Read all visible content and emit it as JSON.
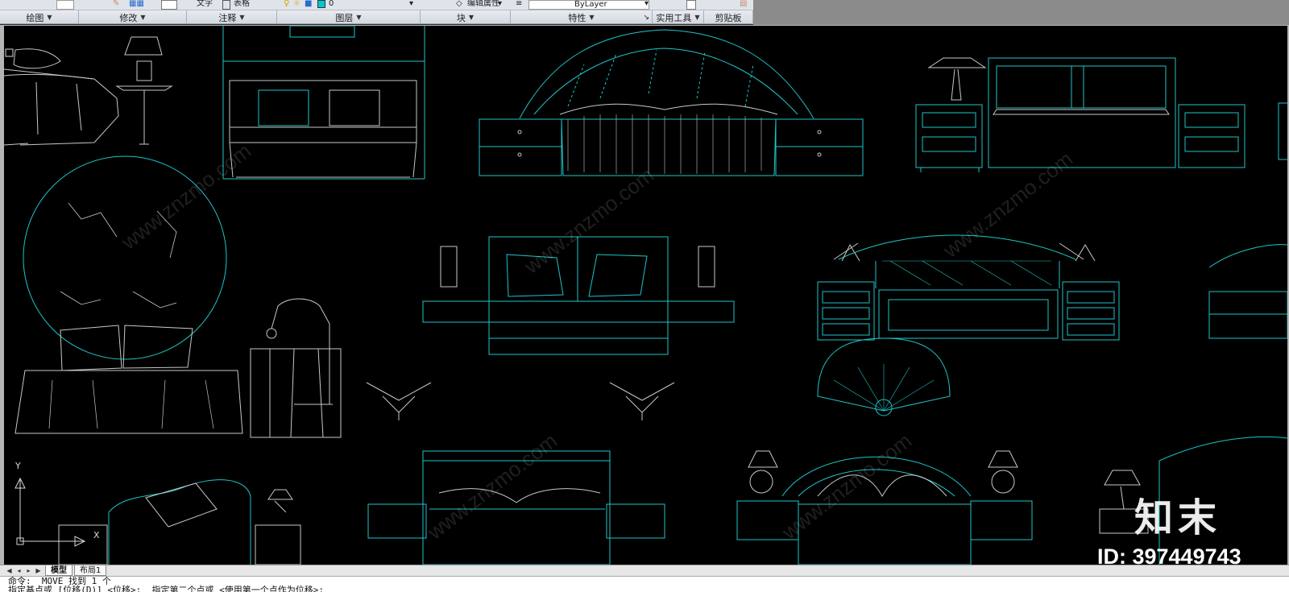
{
  "ribbon_top": {
    "text_label": "文字",
    "table_label": "表格",
    "layer_value": "0",
    "edit_attr_label": "编辑属性",
    "linetype_value": "ByLayer"
  },
  "ribbon_panels": [
    {
      "label": "绘图"
    },
    {
      "label": "修改"
    },
    {
      "label": "注释"
    },
    {
      "label": "图层"
    },
    {
      "label": "块"
    },
    {
      "label": "特性"
    },
    {
      "label": "实用工具"
    },
    {
      "label": "剪贴板"
    }
  ],
  "tabs": {
    "model": "模型",
    "layout1": "布局1"
  },
  "command": {
    "line1": "命令:  MOVE 找到 1 个",
    "line2": "指定基点或 [位移(D)] <位移>:  指定第二个点或 <使用第一个点作为位移>:"
  },
  "ucs": {
    "y_label": "Y",
    "x_label": "X"
  },
  "watermark": {
    "logo": "知末",
    "id": "ID: 397449743",
    "site": "www.znzmo.com"
  },
  "colors": {
    "canvas": "#000000",
    "cad_cyan": "#1fc4c8",
    "cad_white": "#d8d8d8"
  }
}
